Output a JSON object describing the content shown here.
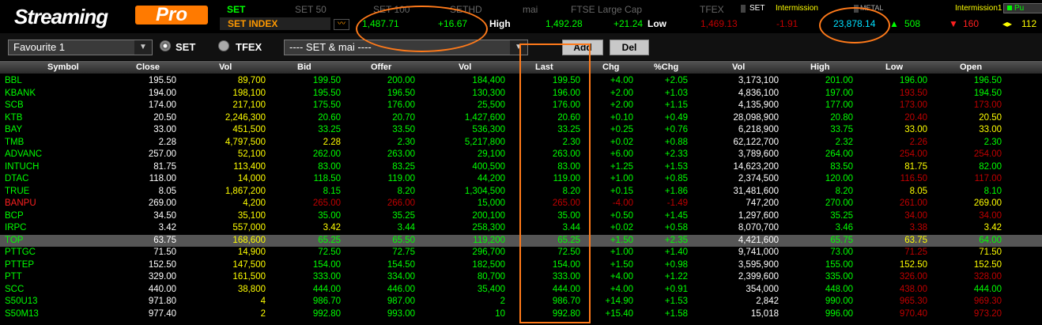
{
  "logo": {
    "part1": "Streaming",
    "part2": "Pro"
  },
  "tabs": [
    "SET",
    "SET 50",
    "SET 100",
    "SETHD",
    "mai",
    "FTSE Large Cap",
    "TFEX"
  ],
  "status": {
    "set_label": "SET",
    "set_status": "Intermission",
    "metal_label": "METAL",
    "metal_status": "Intermission1",
    "pu": "Pu"
  },
  "index": {
    "name": "SET INDEX",
    "value": "1,487.71",
    "change": "+16.67",
    "high_label": "High",
    "high": "1,492.28",
    "high_chg": "+21.24",
    "low_label": "Low",
    "low": "1,469.13",
    "low_chg": "-1.91",
    "value_traded": "23,878.14",
    "up": "508",
    "down": "160",
    "unchanged": "112"
  },
  "controls": {
    "favourite": "Favourite 1",
    "radio_set": "SET",
    "radio_tfex": "TFEX",
    "market_filter": "---- SET & mai ----",
    "add_label": "Add",
    "del_label": "Del"
  },
  "columns": [
    "Symbol",
    "Close",
    "Vol",
    "Bid",
    "Offer",
    "Vol",
    "Last",
    "Chg",
    "%Chg",
    "Vol",
    "High",
    "Low",
    "Open"
  ],
  "rows": [
    {
      "s": "BBL",
      "close": "195.50",
      "vol": "89,700",
      "bid": "199.50",
      "offer": "200.00",
      "ovol": "184,400",
      "last": "199.50",
      "chg": "+4.00",
      "pchg": "+2.05",
      "tvol": "3,173,100",
      "high": "201.00",
      "low": "196.00",
      "open": "196.50",
      "k": [
        "g",
        "w",
        "y",
        "g",
        "g",
        "g",
        "g",
        "g",
        "g",
        "w",
        "g",
        "g",
        "g"
      ]
    },
    {
      "s": "KBANK",
      "close": "194.00",
      "vol": "198,100",
      "bid": "195.50",
      "offer": "196.50",
      "ovol": "130,300",
      "last": "196.00",
      "chg": "+2.00",
      "pchg": "+1.03",
      "tvol": "4,836,100",
      "high": "197.00",
      "low": "193.50",
      "open": "194.50",
      "k": [
        "g",
        "w",
        "y",
        "g",
        "g",
        "g",
        "g",
        "g",
        "g",
        "w",
        "g",
        "dr",
        "g"
      ]
    },
    {
      "s": "SCB",
      "close": "174.00",
      "vol": "217,100",
      "bid": "175.50",
      "offer": "176.00",
      "ovol": "25,500",
      "last": "176.00",
      "chg": "+2.00",
      "pchg": "+1.15",
      "tvol": "4,135,900",
      "high": "177.00",
      "low": "173.00",
      "open": "173.00",
      "k": [
        "g",
        "w",
        "y",
        "g",
        "g",
        "g",
        "g",
        "g",
        "g",
        "w",
        "g",
        "dr",
        "dr"
      ]
    },
    {
      "s": "KTB",
      "close": "20.50",
      "vol": "2,246,300",
      "bid": "20.60",
      "offer": "20.70",
      "ovol": "1,427,600",
      "last": "20.60",
      "chg": "+0.10",
      "pchg": "+0.49",
      "tvol": "28,098,900",
      "high": "20.80",
      "low": "20.40",
      "open": "20.50",
      "k": [
        "g",
        "w",
        "y",
        "g",
        "g",
        "g",
        "g",
        "g",
        "g",
        "w",
        "g",
        "dr",
        "y"
      ]
    },
    {
      "s": "BAY",
      "close": "33.00",
      "vol": "451,500",
      "bid": "33.25",
      "offer": "33.50",
      "ovol": "536,300",
      "last": "33.25",
      "chg": "+0.25",
      "pchg": "+0.76",
      "tvol": "6,218,900",
      "high": "33.75",
      "low": "33.00",
      "open": "33.00",
      "k": [
        "g",
        "w",
        "y",
        "g",
        "g",
        "g",
        "g",
        "g",
        "g",
        "w",
        "g",
        "y",
        "y"
      ]
    },
    {
      "s": "TMB",
      "close": "2.28",
      "vol": "4,797,500",
      "bid": "2.28",
      "offer": "2.30",
      "ovol": "5,217,800",
      "last": "2.30",
      "chg": "+0.02",
      "pchg": "+0.88",
      "tvol": "62,122,700",
      "high": "2.32",
      "low": "2.26",
      "open": "2.30",
      "k": [
        "g",
        "w",
        "y",
        "y",
        "g",
        "g",
        "g",
        "g",
        "g",
        "w",
        "g",
        "dr",
        "g"
      ]
    },
    {
      "s": "ADVANC",
      "close": "257.00",
      "vol": "52,100",
      "bid": "262.00",
      "offer": "263.00",
      "ovol": "29,100",
      "last": "263.00",
      "chg": "+6.00",
      "pchg": "+2.33",
      "tvol": "3,789,600",
      "high": "264.00",
      "low": "254.00",
      "open": "254.00",
      "k": [
        "g",
        "w",
        "y",
        "g",
        "g",
        "g",
        "g",
        "g",
        "g",
        "w",
        "g",
        "dr",
        "dr"
      ]
    },
    {
      "s": "INTUCH",
      "close": "81.75",
      "vol": "113,400",
      "bid": "83.00",
      "offer": "83.25",
      "ovol": "400,500",
      "last": "83.00",
      "chg": "+1.25",
      "pchg": "+1.53",
      "tvol": "14,623,200",
      "high": "83.50",
      "low": "81.75",
      "open": "82.00",
      "k": [
        "g",
        "w",
        "y",
        "g",
        "g",
        "g",
        "g",
        "g",
        "g",
        "w",
        "g",
        "y",
        "g"
      ]
    },
    {
      "s": "DTAC",
      "close": "118.00",
      "vol": "14,000",
      "bid": "118.50",
      "offer": "119.00",
      "ovol": "44,200",
      "last": "119.00",
      "chg": "+1.00",
      "pchg": "+0.85",
      "tvol": "2,374,500",
      "high": "120.00",
      "low": "116.50",
      "open": "117.00",
      "k": [
        "g",
        "w",
        "y",
        "g",
        "g",
        "g",
        "g",
        "g",
        "g",
        "w",
        "g",
        "dr",
        "dr"
      ]
    },
    {
      "s": "TRUE",
      "close": "8.05",
      "vol": "1,867,200",
      "bid": "8.15",
      "offer": "8.20",
      "ovol": "1,304,500",
      "last": "8.20",
      "chg": "+0.15",
      "pchg": "+1.86",
      "tvol": "31,481,600",
      "high": "8.20",
      "low": "8.05",
      "open": "8.10",
      "k": [
        "g",
        "w",
        "y",
        "g",
        "g",
        "g",
        "g",
        "g",
        "g",
        "w",
        "g",
        "y",
        "g"
      ]
    },
    {
      "s": "BANPU",
      "close": "269.00",
      "vol": "4,200",
      "bid": "265.00",
      "offer": "266.00",
      "ovol": "15,000",
      "last": "265.00",
      "chg": "-4.00",
      "pchg": "-1.49",
      "tvol": "747,200",
      "high": "270.00",
      "low": "261.00",
      "open": "269.00",
      "k": [
        "rd",
        "w",
        "y",
        "dr",
        "dr",
        "g",
        "dr",
        "dr",
        "dr",
        "w",
        "g",
        "dr",
        "y"
      ]
    },
    {
      "s": "BCP",
      "close": "34.50",
      "vol": "35,100",
      "bid": "35.00",
      "offer": "35.25",
      "ovol": "200,100",
      "last": "35.00",
      "chg": "+0.50",
      "pchg": "+1.45",
      "tvol": "1,297,600",
      "high": "35.25",
      "low": "34.00",
      "open": "34.00",
      "k": [
        "g",
        "w",
        "y",
        "g",
        "g",
        "g",
        "g",
        "g",
        "g",
        "w",
        "g",
        "dr",
        "dr"
      ]
    },
    {
      "s": "IRPC",
      "close": "3.42",
      "vol": "557,000",
      "bid": "3.42",
      "offer": "3.44",
      "ovol": "258,300",
      "last": "3.44",
      "chg": "+0.02",
      "pchg": "+0.58",
      "tvol": "8,070,700",
      "high": "3.46",
      "low": "3.38",
      "open": "3.42",
      "k": [
        "g",
        "w",
        "y",
        "y",
        "g",
        "g",
        "g",
        "g",
        "g",
        "w",
        "g",
        "dr",
        "y"
      ]
    },
    {
      "s": "TOP",
      "close": "63.75",
      "vol": "168,600",
      "bid": "65.25",
      "offer": "65.50",
      "ovol": "119,200",
      "last": "65.25",
      "chg": "+1.50",
      "pchg": "+2.35",
      "tvol": "4,421,600",
      "high": "65.75",
      "low": "63.75",
      "open": "64.00",
      "k": [
        "g",
        "w",
        "y",
        "g",
        "g",
        "g",
        "g",
        "g",
        "g",
        "w",
        "g",
        "y",
        "g"
      ]
    },
    {
      "s": "PTTGC",
      "close": "71.50",
      "vol": "14,900",
      "bid": "72.50",
      "offer": "72.75",
      "ovol": "296,700",
      "last": "72.50",
      "chg": "+1.00",
      "pchg": "+1.40",
      "tvol": "9,741,000",
      "high": "73.00",
      "low": "71.25",
      "open": "71.50",
      "k": [
        "g",
        "w",
        "y",
        "g",
        "g",
        "g",
        "g",
        "g",
        "g",
        "w",
        "g",
        "dr",
        "y"
      ]
    },
    {
      "s": "PTTEP",
      "close": "152.50",
      "vol": "147,500",
      "bid": "154.00",
      "offer": "154.50",
      "ovol": "182,500",
      "last": "154.00",
      "chg": "+1.50",
      "pchg": "+0.98",
      "tvol": "3,595,900",
      "high": "155.00",
      "low": "152.50",
      "open": "152.50",
      "k": [
        "g",
        "w",
        "y",
        "g",
        "g",
        "g",
        "g",
        "g",
        "g",
        "w",
        "g",
        "y",
        "y"
      ]
    },
    {
      "s": "PTT",
      "close": "329.00",
      "vol": "161,500",
      "bid": "333.00",
      "offer": "334.00",
      "ovol": "80,700",
      "last": "333.00",
      "chg": "+4.00",
      "pchg": "+1.22",
      "tvol": "2,399,600",
      "high": "335.00",
      "low": "326.00",
      "open": "328.00",
      "k": [
        "g",
        "w",
        "y",
        "g",
        "g",
        "g",
        "g",
        "g",
        "g",
        "w",
        "g",
        "dr",
        "dr"
      ]
    },
    {
      "s": "SCC",
      "close": "440.00",
      "vol": "38,800",
      "bid": "444.00",
      "offer": "446.00",
      "ovol": "35,400",
      "last": "444.00",
      "chg": "+4.00",
      "pchg": "+0.91",
      "tvol": "354,000",
      "high": "448.00",
      "low": "438.00",
      "open": "444.00",
      "k": [
        "g",
        "w",
        "y",
        "g",
        "g",
        "g",
        "g",
        "g",
        "g",
        "w",
        "g",
        "dr",
        "g"
      ]
    },
    {
      "s": "S50U13",
      "close": "971.80",
      "vol": "4",
      "bid": "986.70",
      "offer": "987.00",
      "ovol": "2",
      "last": "986.70",
      "chg": "+14.90",
      "pchg": "+1.53",
      "tvol": "2,842",
      "high": "990.00",
      "low": "965.30",
      "open": "969.30",
      "k": [
        "g",
        "w",
        "y",
        "g",
        "g",
        "g",
        "g",
        "g",
        "g",
        "w",
        "g",
        "dr",
        "dr"
      ]
    },
    {
      "s": "S50M13",
      "close": "977.40",
      "vol": "2",
      "bid": "992.80",
      "offer": "993.00",
      "ovol": "10",
      "last": "992.80",
      "chg": "+15.40",
      "pchg": "+1.58",
      "tvol": "15,018",
      "high": "996.00",
      "low": "970.40",
      "open": "973.20",
      "k": [
        "g",
        "w",
        "y",
        "g",
        "g",
        "g",
        "g",
        "g",
        "g",
        "w",
        "g",
        "dr",
        "dr"
      ]
    }
  ]
}
